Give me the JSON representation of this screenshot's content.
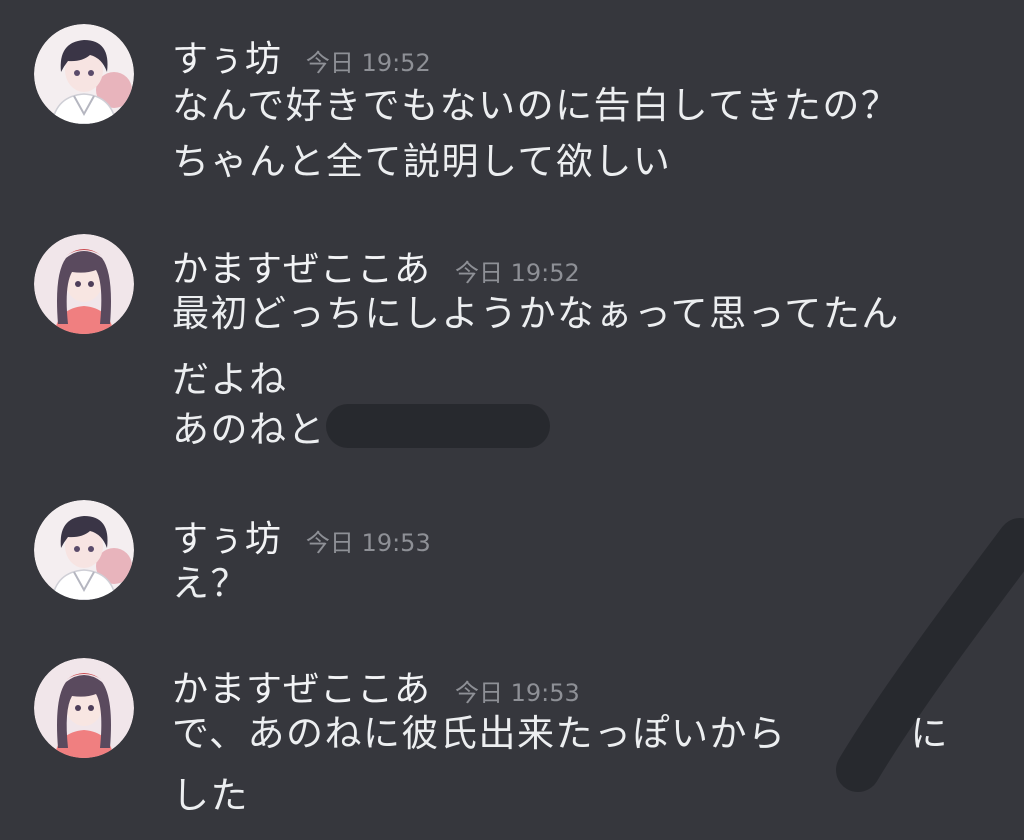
{
  "colors": {
    "background": "#36373d",
    "text": "#eceef0",
    "timestamp": "#8e9096",
    "redaction": "#27292e"
  },
  "messages": [
    {
      "author": "すぅ坊",
      "time": "今日 19:52",
      "avatar": "boy-avatar",
      "lines": [
        "なんで好きでもないのに告白してきたの？",
        "ちゃんと全て説明して欲しい"
      ]
    },
    {
      "author": "かますぜここあ",
      "time": "今日 19:52",
      "avatar": "girl-avatar",
      "lines": [
        "最初どっちにしようかなぁって思ってたん",
        "だよね",
        "あのねと"
      ]
    },
    {
      "author": "すぅ坊",
      "time": "今日 19:53",
      "avatar": "boy-avatar",
      "lines": [
        "え？"
      ]
    },
    {
      "author": "かますぜここあ",
      "time": "今日 19:53",
      "avatar": "girl-avatar",
      "lines": [
        "で、あのねに彼氏出来たっぽいから",
        "に",
        "した"
      ]
    }
  ]
}
